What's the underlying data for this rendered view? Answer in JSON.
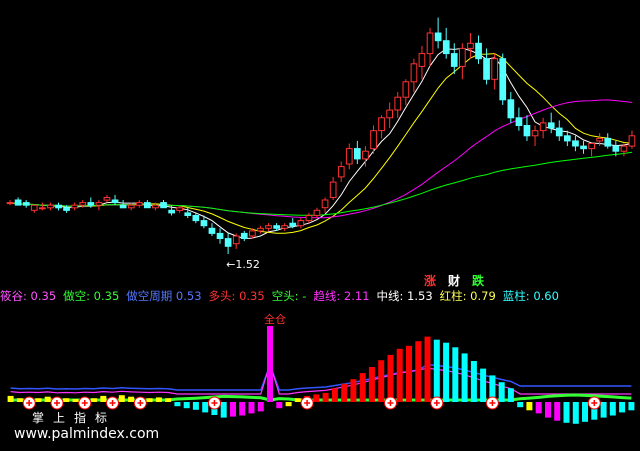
{
  "price_panel": {
    "low_marker_label": "←1.52",
    "signals": [
      {
        "label": "涨",
        "color": "#ff3030"
      },
      {
        "label": "财",
        "color": "#ffffff"
      },
      {
        "label": "跌",
        "color": "#30ff30"
      }
    ]
  },
  "indicator_legend": [
    {
      "label": "筱谷:",
      "value": "0.35",
      "color": "#ff55ff"
    },
    {
      "label": "做空:",
      "value": "0.35",
      "color": "#33ff33"
    },
    {
      "label": "做空周期",
      "value": "0.53",
      "color": "#5577ff"
    },
    {
      "label": "多头:",
      "value": "0.35",
      "color": "#ff3333"
    },
    {
      "label": "空头:",
      "value": "-",
      "color": "#33ff33"
    },
    {
      "label": "趋线:",
      "value": "2.11",
      "color": "#ff33ff"
    },
    {
      "label": "中线:",
      "value": "1.53",
      "color": "#ffffff"
    },
    {
      "label": "红柱:",
      "value": "0.79",
      "color": "#ffff55"
    },
    {
      "label": "蓝柱:",
      "value": "0.60",
      "color": "#33ffff"
    }
  ],
  "indicator_panel": {
    "full_position_label": "全仓"
  },
  "watermark": {
    "title": "掌上指标",
    "url": "www.palmindex.com"
  },
  "chart_data": [
    {
      "type": "candlestick",
      "title": "",
      "ylim": [
        1.45,
        2.45
      ],
      "candles": [
        [
          1.72,
          1.73,
          1.71,
          1.72
        ],
        [
          1.73,
          1.74,
          1.71,
          1.71
        ],
        [
          1.72,
          1.73,
          1.7,
          1.71
        ],
        [
          1.69,
          1.71,
          1.68,
          1.71
        ],
        [
          1.7,
          1.72,
          1.69,
          1.7
        ],
        [
          1.7,
          1.72,
          1.69,
          1.71
        ],
        [
          1.71,
          1.72,
          1.69,
          1.7
        ],
        [
          1.7,
          1.71,
          1.68,
          1.69
        ],
        [
          1.7,
          1.72,
          1.69,
          1.71
        ],
        [
          1.71,
          1.73,
          1.7,
          1.72
        ],
        [
          1.72,
          1.74,
          1.7,
          1.71
        ],
        [
          1.71,
          1.73,
          1.69,
          1.72
        ],
        [
          1.73,
          1.75,
          1.72,
          1.74
        ],
        [
          1.73,
          1.75,
          1.71,
          1.72
        ],
        [
          1.71,
          1.73,
          1.7,
          1.7
        ],
        [
          1.7,
          1.72,
          1.69,
          1.71
        ],
        [
          1.71,
          1.73,
          1.7,
          1.72
        ],
        [
          1.72,
          1.73,
          1.7,
          1.7
        ],
        [
          1.7,
          1.72,
          1.69,
          1.71
        ],
        [
          1.72,
          1.73,
          1.7,
          1.7
        ],
        [
          1.69,
          1.71,
          1.67,
          1.68
        ],
        [
          1.69,
          1.71,
          1.68,
          1.7
        ],
        [
          1.68,
          1.7,
          1.66,
          1.67
        ],
        [
          1.67,
          1.68,
          1.64,
          1.65
        ],
        [
          1.65,
          1.67,
          1.62,
          1.63
        ],
        [
          1.62,
          1.64,
          1.59,
          1.6
        ],
        [
          1.6,
          1.62,
          1.56,
          1.58
        ],
        [
          1.58,
          1.6,
          1.52,
          1.55
        ],
        [
          1.56,
          1.6,
          1.54,
          1.59
        ],
        [
          1.6,
          1.61,
          1.57,
          1.58
        ],
        [
          1.59,
          1.62,
          1.58,
          1.61
        ],
        [
          1.61,
          1.63,
          1.6,
          1.62
        ],
        [
          1.62,
          1.64,
          1.61,
          1.63
        ],
        [
          1.63,
          1.64,
          1.61,
          1.62
        ],
        [
          1.62,
          1.64,
          1.61,
          1.63
        ],
        [
          1.64,
          1.66,
          1.62,
          1.63
        ],
        [
          1.63,
          1.66,
          1.62,
          1.65
        ],
        [
          1.65,
          1.68,
          1.64,
          1.67
        ],
        [
          1.67,
          1.7,
          1.66,
          1.69
        ],
        [
          1.7,
          1.74,
          1.68,
          1.73
        ],
        [
          1.74,
          1.82,
          1.73,
          1.8
        ],
        [
          1.82,
          1.88,
          1.8,
          1.86
        ],
        [
          1.87,
          1.95,
          1.85,
          1.93
        ],
        [
          1.93,
          1.96,
          1.87,
          1.89
        ],
        [
          1.89,
          1.94,
          1.86,
          1.92
        ],
        [
          1.93,
          2.02,
          1.91,
          2.0
        ],
        [
          2.0,
          2.06,
          1.97,
          2.05
        ],
        [
          2.05,
          2.11,
          2.01,
          2.08
        ],
        [
          2.08,
          2.15,
          2.05,
          2.13
        ],
        [
          2.13,
          2.2,
          2.1,
          2.19
        ],
        [
          2.19,
          2.28,
          2.15,
          2.26
        ],
        [
          2.25,
          2.33,
          2.2,
          2.3
        ],
        [
          2.3,
          2.4,
          2.25,
          2.38
        ],
        [
          2.38,
          2.44,
          2.32,
          2.35
        ],
        [
          2.35,
          2.4,
          2.28,
          2.3
        ],
        [
          2.3,
          2.34,
          2.22,
          2.25
        ],
        [
          2.25,
          2.34,
          2.2,
          2.32
        ],
        [
          2.32,
          2.38,
          2.28,
          2.34
        ],
        [
          2.34,
          2.37,
          2.26,
          2.28
        ],
        [
          2.28,
          2.32,
          2.18,
          2.2
        ],
        [
          2.2,
          2.3,
          2.16,
          2.28
        ],
        [
          2.28,
          2.3,
          2.1,
          2.12
        ],
        [
          2.12,
          2.15,
          2.03,
          2.05
        ],
        [
          2.05,
          2.09,
          2.0,
          2.02
        ],
        [
          2.02,
          2.06,
          1.96,
          1.98
        ],
        [
          1.98,
          2.02,
          1.94,
          2.0
        ],
        [
          2.0,
          2.05,
          1.97,
          2.03
        ],
        [
          2.03,
          2.07,
          1.99,
          2.01
        ],
        [
          2.01,
          2.04,
          1.96,
          1.98
        ],
        [
          1.98,
          2.0,
          1.94,
          1.96
        ],
        [
          1.96,
          1.98,
          1.92,
          1.94
        ],
        [
          1.94,
          1.96,
          1.91,
          1.93
        ],
        [
          1.93,
          1.95,
          1.9,
          1.95
        ],
        [
          1.96,
          1.99,
          1.94,
          1.97
        ],
        [
          1.97,
          1.99,
          1.93,
          1.94
        ],
        [
          1.94,
          1.96,
          1.9,
          1.92
        ],
        [
          1.92,
          1.95,
          1.9,
          1.94
        ],
        [
          1.94,
          2.0,
          1.93,
          1.98
        ]
      ],
      "moving_averages": [
        {
          "color": "#ffffff",
          "period": 5
        },
        {
          "color": "#ffff00",
          "period": 10
        },
        {
          "color": "#ff00ff",
          "period": 30
        },
        {
          "color": "#00ff00",
          "period": 60
        }
      ]
    },
    {
      "type": "bar",
      "title": "",
      "ylim": [
        -1,
        1
      ],
      "bars": [
        {
          "v": 0.08,
          "c": "#ffff00"
        },
        {
          "v": 0.05,
          "c": "#ffff00"
        },
        {
          "v": 0.06,
          "c": "#ffff00"
        },
        {
          "v": 0.05,
          "c": "#ffff00"
        },
        {
          "v": 0.07,
          "c": "#ffff00"
        },
        {
          "v": 0.04,
          "c": "#ffff00"
        },
        {
          "v": 0.05,
          "c": "#ffff00"
        },
        {
          "v": 0.04,
          "c": "#ffff00"
        },
        {
          "v": 0.06,
          "c": "#ffff00"
        },
        {
          "v": 0.05,
          "c": "#ffff00"
        },
        {
          "v": 0.08,
          "c": "#ffff00"
        },
        {
          "v": 0.06,
          "c": "#ffff00"
        },
        {
          "v": 0.09,
          "c": "#ffff00"
        },
        {
          "v": 0.07,
          "c": "#ffff00"
        },
        {
          "v": 0.06,
          "c": "#ffff00"
        },
        {
          "v": 0.05,
          "c": "#ffff00"
        },
        {
          "v": 0.06,
          "c": "#ffff00"
        },
        {
          "v": 0.05,
          "c": "#ffff00"
        },
        {
          "v": -0.08,
          "c": "#00ffff"
        },
        {
          "v": -0.12,
          "c": "#00ffff"
        },
        {
          "v": -0.15,
          "c": "#00ffff"
        },
        {
          "v": -0.2,
          "c": "#00ffff"
        },
        {
          "v": -0.25,
          "c": "#00ffff"
        },
        {
          "v": -0.3,
          "c": "#00ffff"
        },
        {
          "v": -0.28,
          "c": "#ff00ff"
        },
        {
          "v": -0.26,
          "c": "#ff00ff"
        },
        {
          "v": -0.22,
          "c": "#ff00ff"
        },
        {
          "v": -0.18,
          "c": "#ff00ff"
        },
        {
          "v": 1.0,
          "c": "#ff00ff"
        },
        {
          "v": -0.12,
          "c": "#ff00ff"
        },
        {
          "v": -0.08,
          "c": "#ffff00"
        },
        {
          "v": 0.05,
          "c": "#ffff00"
        },
        {
          "v": 0.08,
          "c": "#ff0000"
        },
        {
          "v": 0.1,
          "c": "#ff0000"
        },
        {
          "v": 0.12,
          "c": "#ff0000"
        },
        {
          "v": 0.18,
          "c": "#ff0000"
        },
        {
          "v": 0.24,
          "c": "#ff0000"
        },
        {
          "v": 0.3,
          "c": "#ff0000"
        },
        {
          "v": 0.38,
          "c": "#ff0000"
        },
        {
          "v": 0.46,
          "c": "#ff0000"
        },
        {
          "v": 0.55,
          "c": "#ff0000"
        },
        {
          "v": 0.62,
          "c": "#ff0000"
        },
        {
          "v": 0.7,
          "c": "#ff0000"
        },
        {
          "v": 0.74,
          "c": "#ff0000"
        },
        {
          "v": 0.8,
          "c": "#ff0000"
        },
        {
          "v": 0.86,
          "c": "#ff0000"
        },
        {
          "v": 0.82,
          "c": "#00ffff"
        },
        {
          "v": 0.78,
          "c": "#00ffff"
        },
        {
          "v": 0.72,
          "c": "#00ffff"
        },
        {
          "v": 0.64,
          "c": "#00ffff"
        },
        {
          "v": 0.54,
          "c": "#00ffff"
        },
        {
          "v": 0.44,
          "c": "#00ffff"
        },
        {
          "v": 0.35,
          "c": "#00ffff"
        },
        {
          "v": 0.26,
          "c": "#00ffff"
        },
        {
          "v": 0.18,
          "c": "#00ffff"
        },
        {
          "v": -0.1,
          "c": "#00ffff"
        },
        {
          "v": -0.16,
          "c": "#ffff00"
        },
        {
          "v": -0.22,
          "c": "#ff00ff"
        },
        {
          "v": -0.3,
          "c": "#ff00ff"
        },
        {
          "v": -0.36,
          "c": "#ff00ff"
        },
        {
          "v": -0.4,
          "c": "#00ffff"
        },
        {
          "v": -0.42,
          "c": "#00ffff"
        },
        {
          "v": -0.38,
          "c": "#00ffff"
        },
        {
          "v": -0.34,
          "c": "#00ffff"
        },
        {
          "v": -0.3,
          "c": "#00ffff"
        },
        {
          "v": -0.26,
          "c": "#00ffff"
        },
        {
          "v": -0.2,
          "c": "#00ffff"
        },
        {
          "v": -0.16,
          "c": "#00ffff"
        }
      ],
      "signal_markers": [
        2,
        5,
        8,
        11,
        14,
        22,
        32,
        41,
        46,
        52,
        63
      ]
    }
  ]
}
